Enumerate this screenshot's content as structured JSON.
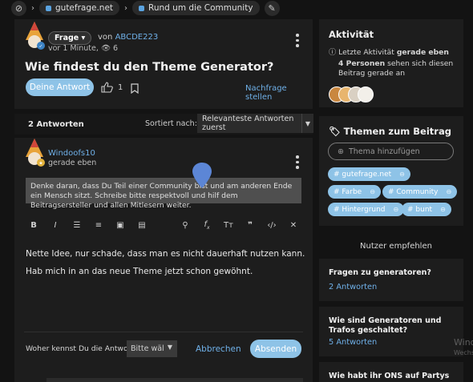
{
  "breadcrumb": {
    "items": [
      "gutefrage.net",
      "Rund um die Community"
    ]
  },
  "question": {
    "type_label": "Frage",
    "from_prefix": "von",
    "author": "ABCDE223",
    "meta": "vor 1 Minute,",
    "views": "6",
    "title": "Wie findest du den Theme Generator?",
    "answer_button": "Deine Antwort",
    "likes": "1",
    "follow_up": "Nachfrage stellen"
  },
  "answers": {
    "count_label": "2 Antworten",
    "sort_label": "Sortiert nach:",
    "sort_value": "Relevanteste Antworten zuerst"
  },
  "editor": {
    "user": "Windoofs10",
    "time": "gerade eben",
    "hint": "Denke daran, dass Du Teil einer Community bist und am anderen Ende ein Mensch sitzt. Schreibe bitte respektvoll und hilf dem Beitragsersteller und allen Mitlesern weiter.",
    "paragraph1": "Nette Idee, nur schade, dass man es nicht dauerhaft nutzen kann.",
    "paragraph2": "Hab mich in an das neue Theme jetzt schon gewöhnt.",
    "source_label": "Woher kennst Du die Antwort?",
    "source_value": "Bitte wäl",
    "cancel": "Abbrechen",
    "submit": "Absenden"
  },
  "activity": {
    "title": "Aktivität",
    "last": "Letzte Aktivität",
    "last_bold": "gerade eben",
    "persons_bold": "4 Personen",
    "persons_rest": "sehen sich diesen Beitrag gerade an"
  },
  "themes": {
    "title": "Themen zum Beitrag",
    "placeholder": "Thema hinzufügen",
    "tags": [
      "# gutefrage.net",
      "# Farbe",
      "# Community",
      "# Hintergrund",
      "# bunt"
    ]
  },
  "recommend": {
    "title": "Nutzer empfehlen",
    "items": [
      {
        "title": "Fragen zu generatoren?",
        "link": "2 Antworten"
      },
      {
        "title": "Wie sind Generatoren und Trafos geschaltet?",
        "link": "5 Antworten"
      },
      {
        "title": "Wie habt ihr ONS auf Partys",
        "link": ""
      }
    ]
  },
  "watermark": {
    "line1": "Wind",
    "line2": "Wechs"
  },
  "colors": {
    "accent": "#8ec3e7",
    "link": "#6fb0e8",
    "card": "#1d1d1d",
    "background": "#131313"
  }
}
